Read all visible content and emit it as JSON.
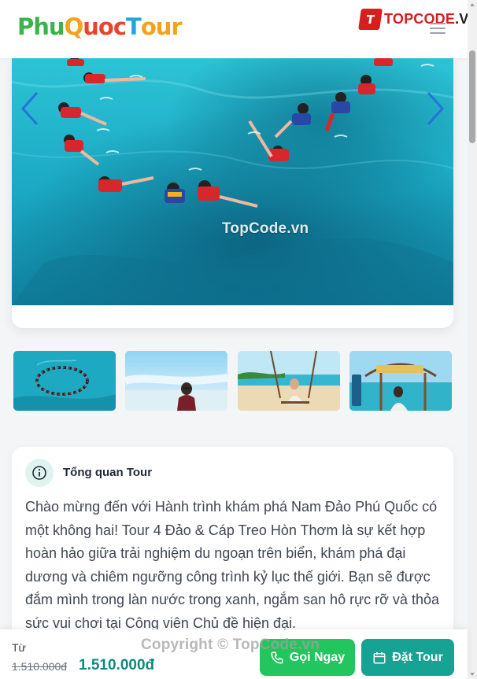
{
  "header": {
    "logo_letters": [
      {
        "ch": "P",
        "color": "#3bb34a"
      },
      {
        "ch": "h",
        "color": "#3bb34a"
      },
      {
        "ch": "u",
        "color": "#3bb34a"
      },
      {
        "ch": "Q",
        "color": "#f4a21b"
      },
      {
        "ch": "u",
        "color": "#e8452c"
      },
      {
        "ch": "o",
        "color": "#e8452c"
      },
      {
        "ch": "c",
        "color": "#e8452c"
      },
      {
        "ch": "T",
        "color": "#1da7dd"
      },
      {
        "ch": "o",
        "color": "#f4a21b"
      },
      {
        "ch": "u",
        "color": "#f4a21b"
      },
      {
        "ch": "r",
        "color": "#f4a21b"
      }
    ],
    "watermark": {
      "badge": "T",
      "main": "TOPCODE",
      "suffix": ".VN"
    },
    "menu_icon": "hamburger-icon"
  },
  "hero": {
    "watermark": "TopCode.vn",
    "prev_icon": "chevron-left-icon",
    "next_icon": "chevron-right-icon"
  },
  "thumbnails": [
    {
      "name": "snorkel-circle"
    },
    {
      "name": "beach-girl"
    },
    {
      "name": "beach-swing"
    },
    {
      "name": "island-sign"
    }
  ],
  "overview": {
    "icon": "info-icon",
    "title": "Tổng quan Tour",
    "text": "Chào mừng đến với Hành trình khám phá Nam Đảo Phú Quốc có một không hai! Tour 4 Đảo & Cáp Treo Hòn Thơm là sự kết hợp hoàn hảo giữa trải nghiệm du ngoạn trên biển, khám phá đại dương và chiêm ngưỡng công trình kỷ lục thế giới. Bạn sẽ được đắm mình trong làn nước trong xanh, ngắm san hô rực rỡ và thỏa sức vui chơi tại Công viên Chủ đề hiện đại."
  },
  "booking_bar": {
    "from_label": "Từ",
    "old_price": "1.510.000đ",
    "new_price": "1.510.000đ",
    "call_button": "Gọi Ngay",
    "book_button": "Đặt Tour",
    "call_color": "#22c55e",
    "book_color": "#16a394"
  },
  "copyright": "Copyright © TopCode.vn"
}
